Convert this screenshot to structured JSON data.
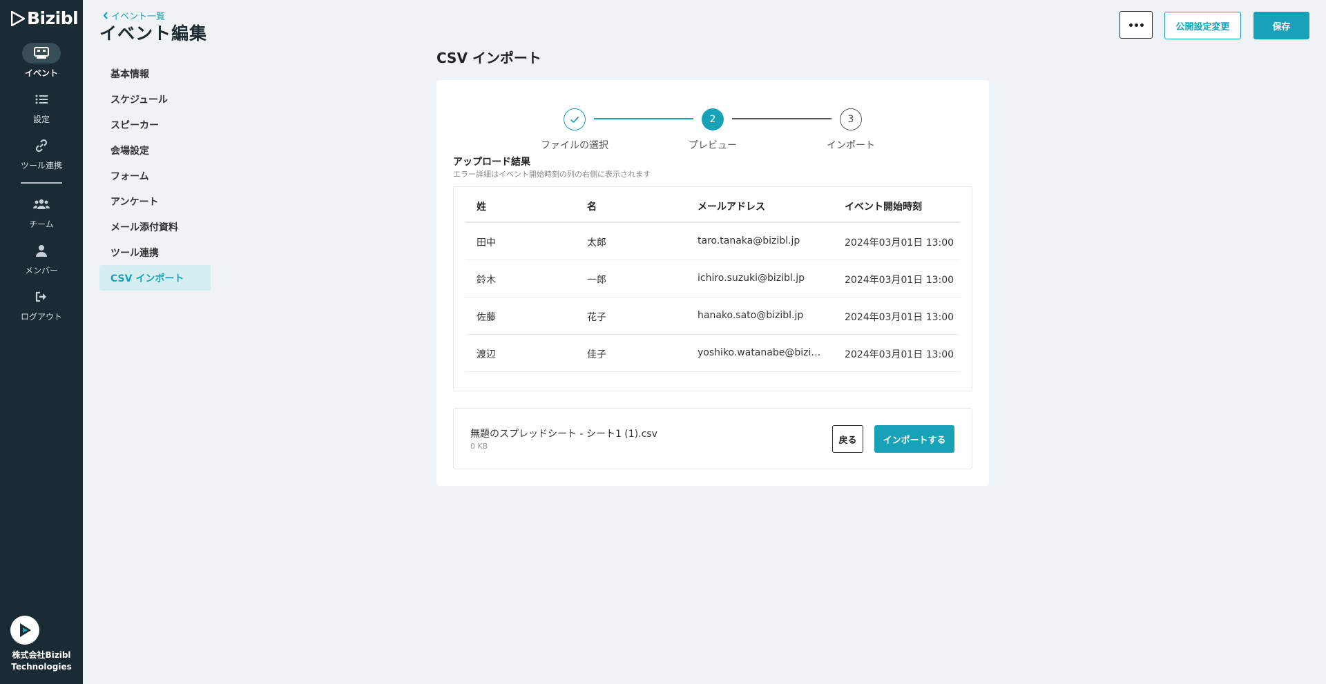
{
  "app": {
    "logo_text": "Bizibl"
  },
  "rail": {
    "items": [
      {
        "label": "イベント",
        "icon": "event-grid-icon",
        "active": true
      },
      {
        "label": "設定",
        "icon": "list-icon",
        "active": false
      },
      {
        "label": "ツール連携",
        "icon": "link-icon",
        "active": false
      },
      {
        "label": "チーム",
        "icon": "team-icon",
        "active": false
      },
      {
        "label": "メンバー",
        "icon": "person-icon",
        "active": false
      },
      {
        "label": "ログアウト",
        "icon": "logout-icon",
        "active": false
      }
    ],
    "company_line1": "株式会社Bizibl",
    "company_line2": "Technologies"
  },
  "header": {
    "back_link": "イベント一覧",
    "title": "イベント編集",
    "publish_label": "公開設定変更",
    "save_label": "保存"
  },
  "subnav": {
    "items": [
      {
        "label": "基本情報",
        "active": false
      },
      {
        "label": "スケジュール",
        "active": false
      },
      {
        "label": "スピーカー",
        "active": false
      },
      {
        "label": "会場設定",
        "active": false
      },
      {
        "label": "フォーム",
        "active": false
      },
      {
        "label": "アンケート",
        "active": false
      },
      {
        "label": "メール添付資料",
        "active": false
      },
      {
        "label": "ツール連携",
        "active": false
      },
      {
        "label": "CSV インポート",
        "active": true
      }
    ]
  },
  "main": {
    "section_title": "CSV インポート",
    "steps": [
      {
        "number": "1",
        "label": "ファイルの選択",
        "state": "done"
      },
      {
        "number": "2",
        "label": "プレビュー",
        "state": "current"
      },
      {
        "number": "3",
        "label": "インポート",
        "state": "pending"
      }
    ],
    "result_title": "アップロード結果",
    "result_subtitle": "エラー詳細はイベント開始時刻の列の右側に表示されます",
    "table": {
      "columns": [
        "姓",
        "名",
        "メールアドレス",
        "イベント開始時刻"
      ],
      "rows": [
        [
          "田中",
          "太郎",
          "taro.tanaka@bizibl.jp",
          "2024年03月01日 13:00"
        ],
        [
          "鈴木",
          "一郎",
          "ichiro.suzuki@bizibl.jp",
          "2024年03月01日 13:00"
        ],
        [
          "佐藤",
          "花子",
          "hanako.sato@bizibl.jp",
          "2024年03月01日 13:00"
        ],
        [
          "渡辺",
          "佳子",
          "yoshiko.watanabe@bizibl.jp",
          "2024年03月01日 13:00"
        ]
      ]
    },
    "file": {
      "name": "無題のスプレッドシート - シート1 (1).csv",
      "size": "0 KB"
    },
    "back_label": "戻る",
    "import_label": "インポートする"
  },
  "colors": {
    "accent": "#17a2b8",
    "rail_bg": "#1a2b33",
    "page_bg": "#eff3f6"
  }
}
